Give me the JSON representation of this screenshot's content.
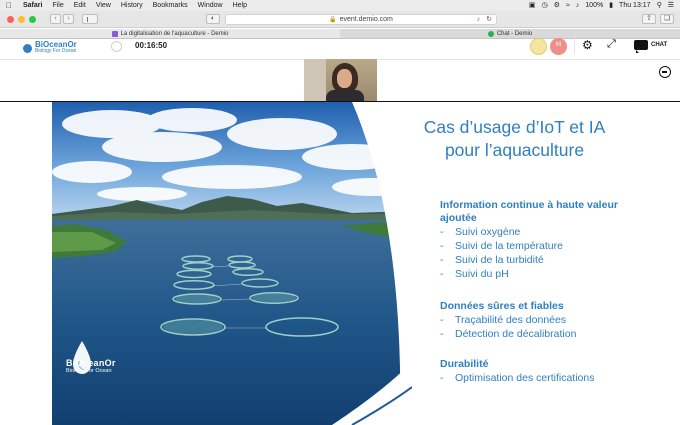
{
  "menubar": {
    "apple": "",
    "items": [
      "Safari",
      "File",
      "Edit",
      "View",
      "History",
      "Bookmarks",
      "Window",
      "Help"
    ],
    "battery": "100%",
    "clock": "Thu 13:17"
  },
  "browser": {
    "url": "event.demio.com",
    "tabs": [
      {
        "title": "La digitalisation de l'aquaculture - Demio",
        "icon_color": "#8a5cd6"
      },
      {
        "title": "Chat - Demio",
        "icon_color": "#27b34a"
      }
    ]
  },
  "app": {
    "logo_name": "BiOceanOr",
    "logo_tagline": "Biology For Ocean",
    "timer": "00:16:50",
    "avatar2": "M",
    "chat_label": "CHAT"
  },
  "slide": {
    "title": "Cas d’usage d’IoT et IA pour l’aquaculture",
    "sections": [
      {
        "heading": "Information continue à haute valeur ajoutée",
        "items": [
          "Suivi oxygène",
          "Suivi de la température",
          "Suivi de la turbidité",
          "Suivi du pH"
        ]
      },
      {
        "heading": "Données sûres et fiables",
        "items": [
          "Traçabilité des données",
          "Détection de décalibration"
        ]
      },
      {
        "heading": "Durabilité",
        "items": [
          "Optimisation des certifications"
        ]
      }
    ],
    "brand_name": "BiOceanOr",
    "brand_tagline": "Biology For Ocean"
  },
  "colors": {
    "accent": "#2f7fc1"
  }
}
